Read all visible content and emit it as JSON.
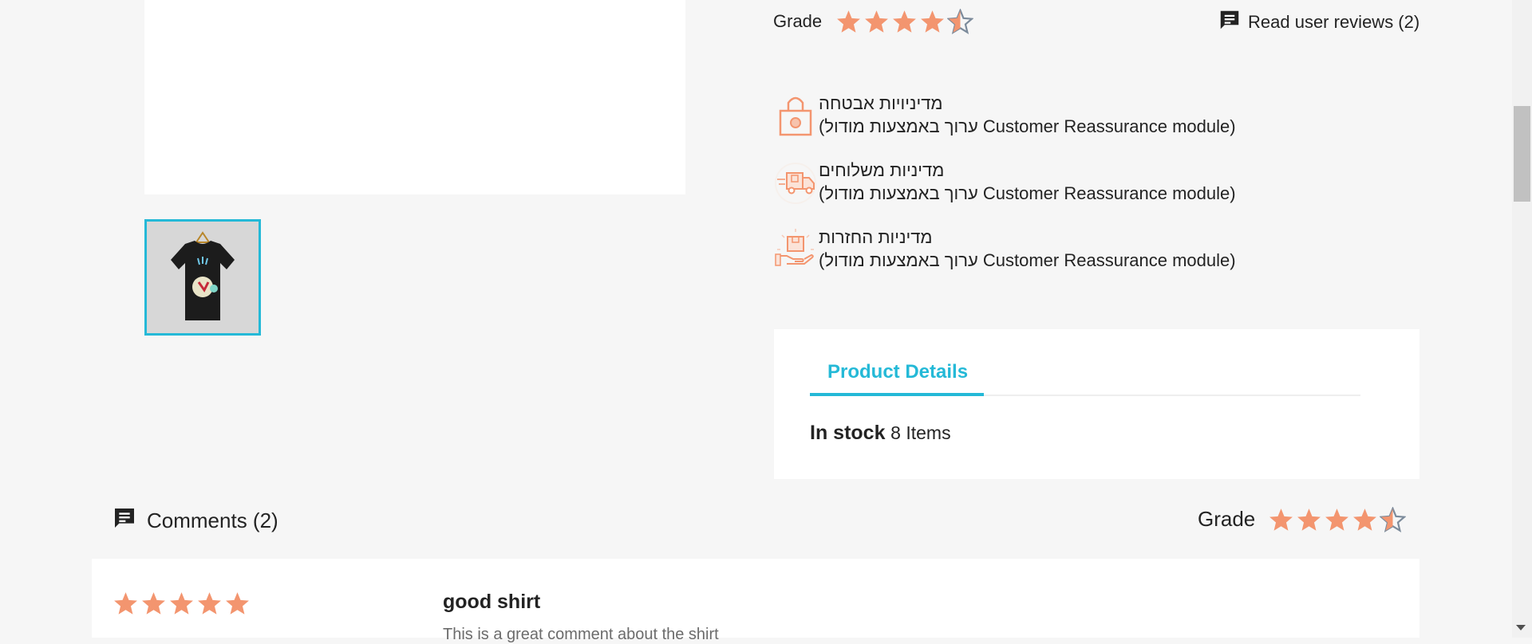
{
  "colors": {
    "accent": "#24b9d7",
    "star": "#f3956f",
    "star_empty": "#7c8b9b",
    "icon_orange": "#f3956f"
  },
  "rating_top": {
    "label": "Grade",
    "value": 4.5,
    "max": 5
  },
  "reviews_link": {
    "label": "Read user reviews (2)",
    "icon": "comment-icon"
  },
  "reassurance": [
    {
      "icon": "lock-icon",
      "title": "מדיניויות אבטחה",
      "desc": "(ערוך באמצעות מודול Customer Reassurance module)"
    },
    {
      "icon": "truck-icon",
      "title": "מדיניות משלוחים",
      "desc": "(ערוך באמצעות מודול Customer Reassurance module)"
    },
    {
      "icon": "return-box-icon",
      "title": "מדיניות החזרות",
      "desc": "(ערוך באמצעות מודול Customer Reassurance module)"
    }
  ],
  "details": {
    "tab_label": "Product Details",
    "stock_label": "In stock",
    "stock_count": "8 Items"
  },
  "comments": {
    "header": "Comments (2)",
    "icon": "comment-icon",
    "grade_label": "Grade",
    "grade_value": 4.5
  },
  "review": {
    "rating": 5,
    "title": "good shirt",
    "body": "This is a great comment about the shirt"
  }
}
